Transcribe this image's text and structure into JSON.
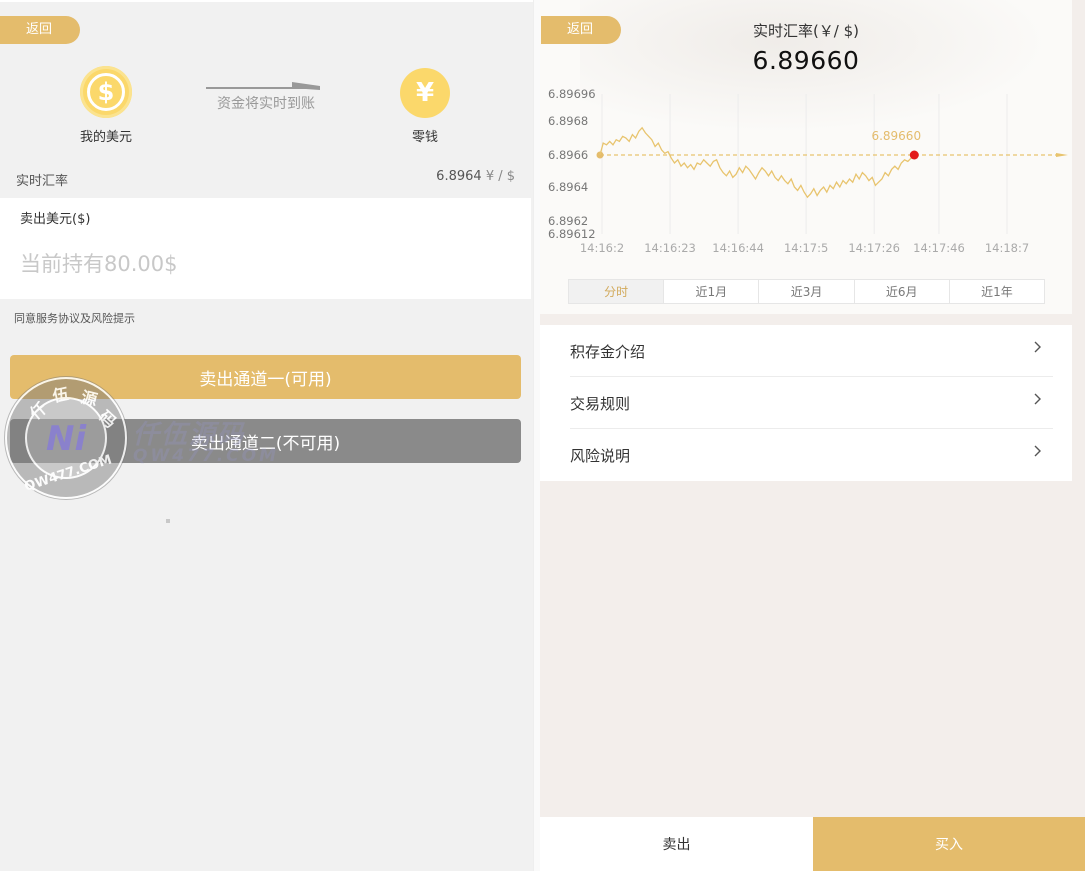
{
  "left": {
    "back_label": "返回",
    "usd_label": "我的美元",
    "cash_label": "零钱",
    "transfer_text": "资金将实时到账",
    "rate_label": "实时汇率",
    "rate_value": "6.8964",
    "rate_unit": "¥ / $",
    "sell_label": "卖出美元($)",
    "sell_placeholder": "当前持有80.00$",
    "agreement": "同意服务协议及风险提示",
    "channel_1": "卖出通道一(可用)",
    "channel_2": "卖出通道二(不可用)",
    "icons": {
      "usd": "dollar-coin-icon",
      "cash": "yen-coin-icon"
    }
  },
  "watermark": {
    "ring_chars": [
      "仟",
      "伍",
      "源",
      "码"
    ],
    "ring_bottom": "QW477.COM",
    "logo": "Ni",
    "site_text": "仟伍源码",
    "site_sub": "QW477.COM"
  },
  "right": {
    "back_label": "返回",
    "title": "实时汇率(￥/ $)",
    "price": "6.89660",
    "tabs": [
      {
        "label": "分时",
        "active": true
      },
      {
        "label": "近1月",
        "active": false
      },
      {
        "label": "近3月",
        "active": false
      },
      {
        "label": "近6月",
        "active": false
      },
      {
        "label": "近1年",
        "active": false
      }
    ],
    "menu": [
      {
        "label": "积存金介绍"
      },
      {
        "label": "交易规则"
      },
      {
        "label": "风险说明"
      }
    ],
    "sell_label": "卖出",
    "buy_label": "买入"
  },
  "colors": {
    "accent": "#e4bc6c",
    "disabled": "#8a8a8a",
    "line": "#e8c46e",
    "marker": "#e31b1b"
  },
  "chart_data": {
    "type": "line",
    "y_ticks": [
      "6.89696",
      "6.8968",
      "6.8966",
      "6.8964",
      "6.8962",
      "6.89612"
    ],
    "y_tick_values": [
      6.89696,
      6.8968,
      6.8966,
      6.8964,
      6.8962,
      6.89612
    ],
    "ylim": [
      6.89612,
      6.89696
    ],
    "x_ticks": [
      "14:16:2",
      "14:16:23",
      "14:16:44",
      "14:17:5",
      "14:17:26",
      "14:17:46",
      "14:18:7"
    ],
    "x_tick_seconds": [
      2,
      23,
      44,
      65,
      86,
      106,
      127
    ],
    "xlim_seconds": [
      2,
      127
    ],
    "reference_value": 6.8966,
    "current_label": "6.89660",
    "current": {
      "t": 99,
      "value": 6.8966
    },
    "series": [
      {
        "values": [
          [
            2,
            6.8966
          ],
          [
            3,
            6.89667
          ],
          [
            4,
            6.89666
          ],
          [
            5,
            6.89668
          ],
          [
            6,
            6.89666
          ],
          [
            7,
            6.89669
          ],
          [
            8,
            6.89668
          ],
          [
            9,
            6.89671
          ],
          [
            10,
            6.8967
          ],
          [
            11,
            6.89668
          ],
          [
            12,
            6.89672
          ],
          [
            13,
            6.8967
          ],
          [
            14,
            6.89674
          ],
          [
            15,
            6.89676
          ],
          [
            16,
            6.89673
          ],
          [
            17,
            6.89671
          ],
          [
            18,
            6.89669
          ],
          [
            19,
            6.89665
          ],
          [
            20,
            6.89667
          ],
          [
            21,
            6.89663
          ],
          [
            22,
            6.89661
          ],
          [
            23,
            6.89662
          ],
          [
            24,
            6.89658
          ],
          [
            25,
            6.89655
          ],
          [
            26,
            6.89657
          ],
          [
            27,
            6.89653
          ],
          [
            28,
            6.89655
          ],
          [
            29,
            6.89652
          ],
          [
            30,
            6.89654
          ],
          [
            31,
            6.89651
          ],
          [
            32,
            6.89655
          ],
          [
            33,
            6.89654
          ],
          [
            34,
            6.89657
          ],
          [
            35,
            6.89655
          ],
          [
            36,
            6.89653
          ],
          [
            37,
            6.89656
          ],
          [
            38,
            6.89657
          ],
          [
            39,
            6.89652
          ],
          [
            40,
            6.89649
          ],
          [
            41,
            6.89647
          ],
          [
            42,
            6.8965
          ],
          [
            43,
            6.89646
          ],
          [
            44,
            6.89648
          ],
          [
            45,
            6.89652
          ],
          [
            46,
            6.89649
          ],
          [
            47,
            6.89653
          ],
          [
            48,
            6.89651
          ],
          [
            49,
            6.89648
          ],
          [
            50,
            6.89645
          ],
          [
            51,
            6.89649
          ],
          [
            52,
            6.89652
          ],
          [
            53,
            6.8965
          ],
          [
            54,
            6.89647
          ],
          [
            55,
            6.8965
          ],
          [
            56,
            6.89646
          ],
          [
            57,
            6.89644
          ],
          [
            58,
            6.89647
          ],
          [
            59,
            6.89644
          ],
          [
            60,
            6.89642
          ],
          [
            61,
            6.89645
          ],
          [
            62,
            6.8964
          ],
          [
            63,
            6.89638
          ],
          [
            64,
            6.89641
          ],
          [
            65,
            6.89637
          ],
          [
            66,
            6.89634
          ],
          [
            67,
            6.89636
          ],
          [
            68,
            6.89639
          ],
          [
            69,
            6.89635
          ],
          [
            70,
            6.89638
          ],
          [
            71,
            6.8964
          ],
          [
            72,
            6.89637
          ],
          [
            73,
            6.89641
          ],
          [
            74,
            6.89639
          ],
          [
            75,
            6.89643
          ],
          [
            76,
            6.8964
          ],
          [
            77,
            6.89644
          ],
          [
            78,
            6.89642
          ],
          [
            79,
            6.89645
          ],
          [
            80,
            6.89643
          ],
          [
            81,
            6.89648
          ],
          [
            82,
            6.89645
          ],
          [
            83,
            6.89649
          ],
          [
            84,
            6.89647
          ],
          [
            85,
            6.89644
          ],
          [
            86,
            6.89646
          ],
          [
            87,
            6.89641
          ],
          [
            88,
            6.89643
          ],
          [
            89,
            6.89645
          ],
          [
            90,
            6.89649
          ],
          [
            91,
            6.89647
          ],
          [
            92,
            6.89651
          ],
          [
            93,
            6.89653
          ],
          [
            94,
            6.89651
          ],
          [
            95,
            6.89655
          ],
          [
            96,
            6.89657
          ],
          [
            97,
            6.89656
          ],
          [
            98,
            6.89658
          ],
          [
            99,
            6.8966
          ]
        ]
      }
    ],
    "grid": true
  }
}
